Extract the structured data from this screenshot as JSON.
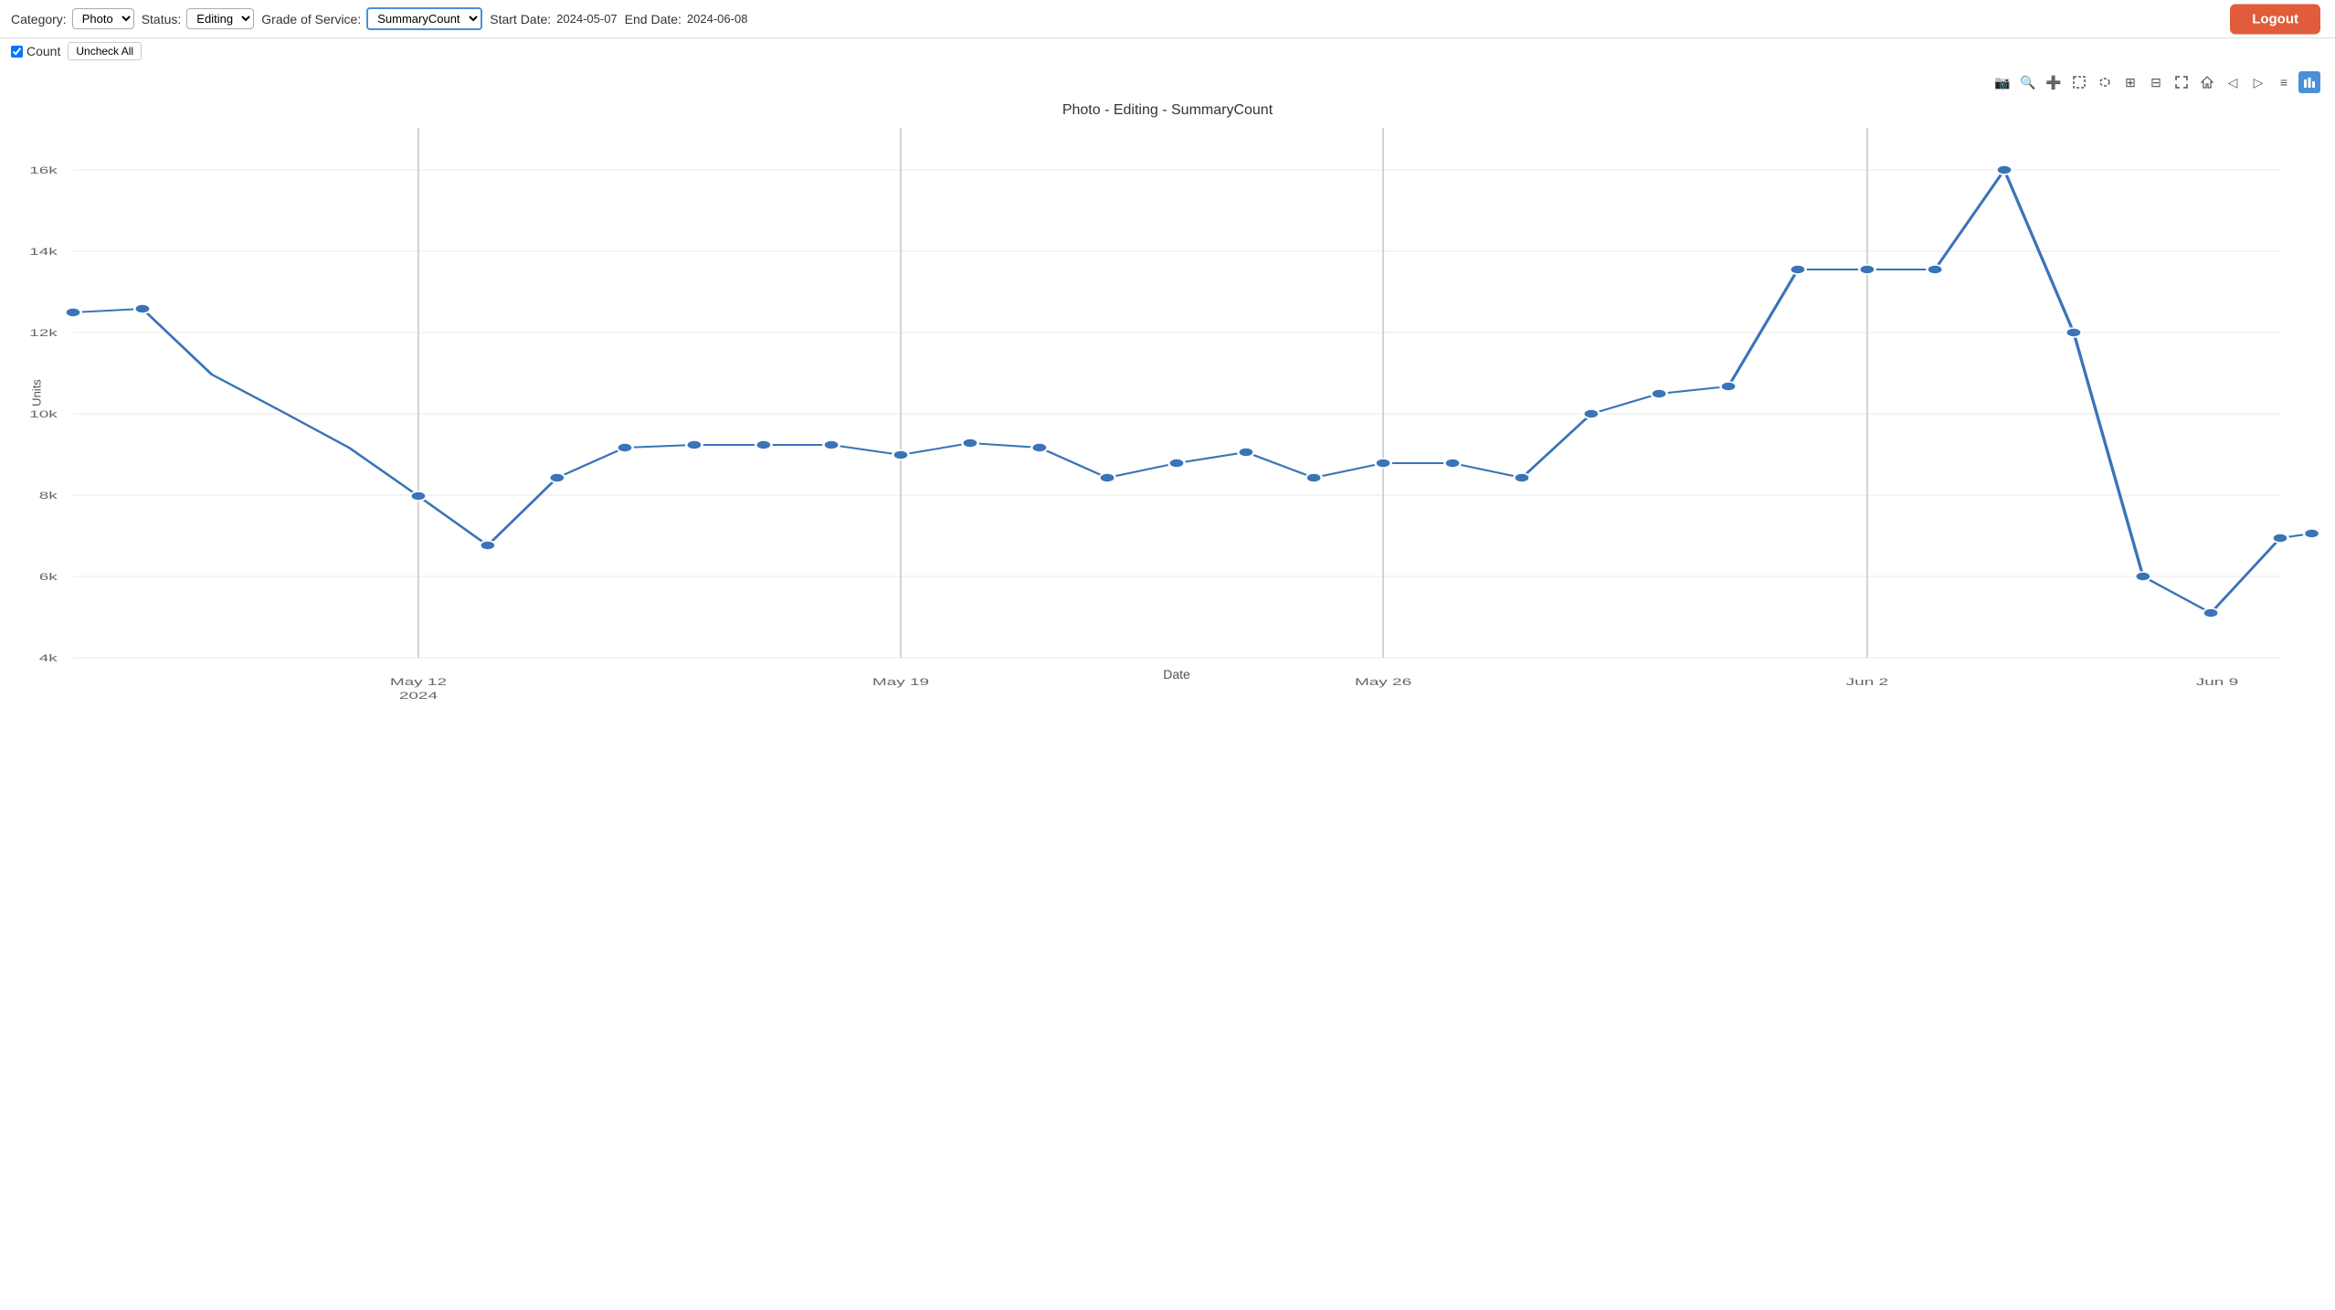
{
  "header": {
    "category_label": "Category:",
    "category_value": "Photo",
    "status_label": "Status:",
    "status_value": "Editing",
    "grade_label": "Grade of Service:",
    "grade_value": "SummaryCount",
    "start_date_label": "Start Date:",
    "start_date_value": "2024-05-07",
    "end_date_label": "End Date:",
    "end_date_value": "2024-06-08",
    "logout_label": "Logout",
    "count_label": "Count",
    "uncheck_label": "Uncheck All"
  },
  "chart": {
    "title": "Photo - Editing - SummaryCount",
    "y_axis_label": "Units",
    "x_axis_label": "Date",
    "y_ticks": [
      "4k",
      "6k",
      "8k",
      "10k",
      "12k",
      "14k",
      "16k"
    ],
    "x_ticks": [
      "May 12\n2024",
      "May 19",
      "May 26",
      "Jun 2",
      "Jun 9"
    ],
    "toolbar_icons": [
      {
        "name": "camera-icon",
        "symbol": "📷"
      },
      {
        "name": "zoom-icon",
        "symbol": "🔍"
      },
      {
        "name": "plus-icon",
        "symbol": "+"
      },
      {
        "name": "selection-icon",
        "symbol": "⬚"
      },
      {
        "name": "lasso-icon",
        "symbol": "◌"
      },
      {
        "name": "add-shape-icon",
        "symbol": "⊞"
      },
      {
        "name": "minus-shape-icon",
        "symbol": "⊟"
      },
      {
        "name": "expand-icon",
        "symbol": "⛶"
      },
      {
        "name": "home-icon",
        "symbol": "⌂"
      },
      {
        "name": "arrow-icon",
        "symbol": "↔"
      },
      {
        "name": "line-icon",
        "symbol": "—"
      },
      {
        "name": "bar-icon",
        "symbol": "≡"
      },
      {
        "name": "chart-icon",
        "symbol": "📊",
        "active": true
      }
    ]
  }
}
